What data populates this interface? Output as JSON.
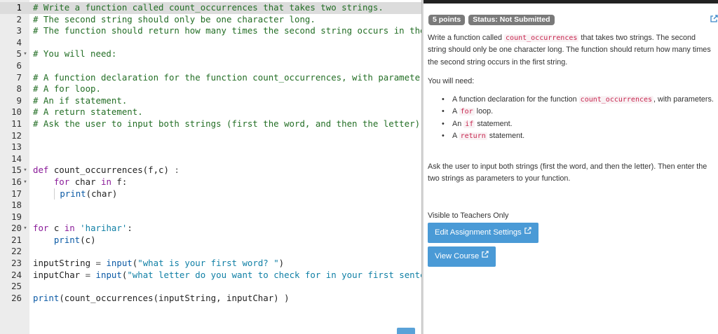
{
  "editor": {
    "lines": [
      {
        "n": "1",
        "fold": "",
        "parts": [
          [
            "comment",
            "# Write a function called count_occurrences that takes two strings."
          ]
        ]
      },
      {
        "n": "2",
        "fold": "",
        "parts": [
          [
            "comment",
            "# The second string should only be one character long."
          ]
        ]
      },
      {
        "n": "3",
        "fold": "",
        "parts": [
          [
            "comment",
            "# The function should return how many times the second string occurs in the"
          ]
        ]
      },
      {
        "n": "4",
        "fold": "",
        "parts": []
      },
      {
        "n": "5",
        "fold": "▾",
        "parts": [
          [
            "comment",
            "# You will need:"
          ]
        ]
      },
      {
        "n": "6",
        "fold": "",
        "parts": []
      },
      {
        "n": "7",
        "fold": "",
        "parts": [
          [
            "comment",
            "# A function declaration for the function count_occurrences, with parameters"
          ]
        ]
      },
      {
        "n": "8",
        "fold": "",
        "parts": [
          [
            "comment",
            "# A for loop."
          ]
        ]
      },
      {
        "n": "9",
        "fold": "",
        "parts": [
          [
            "comment",
            "# An if statement."
          ]
        ]
      },
      {
        "n": "10",
        "fold": "",
        "parts": [
          [
            "comment",
            "# A return statement."
          ]
        ]
      },
      {
        "n": "11",
        "fold": "",
        "parts": [
          [
            "comment",
            "# Ask the user to input both strings (first the word, and then the letter)."
          ]
        ]
      },
      {
        "n": "12",
        "fold": "",
        "parts": []
      },
      {
        "n": "13",
        "fold": "",
        "parts": []
      },
      {
        "n": "14",
        "fold": "",
        "parts": []
      },
      {
        "n": "15",
        "fold": "▾",
        "parts": [
          [
            "keyword",
            "def"
          ],
          [
            "plain",
            " count_occurrences(f,c) "
          ],
          [
            "op",
            ":"
          ]
        ]
      },
      {
        "n": "16",
        "fold": "▾",
        "parts": [
          [
            "plain",
            "    "
          ],
          [
            "keyword",
            "for"
          ],
          [
            "plain",
            " char "
          ],
          [
            "keyword",
            "in"
          ],
          [
            "plain",
            " f:"
          ]
        ]
      },
      {
        "n": "17",
        "fold": "",
        "parts": [
          [
            "plain",
            "    "
          ],
          [
            "guide",
            ""
          ],
          [
            "plain",
            " "
          ],
          [
            "builtin",
            "print"
          ],
          [
            "plain",
            "(char)"
          ]
        ]
      },
      {
        "n": "18",
        "fold": "",
        "parts": []
      },
      {
        "n": "19",
        "fold": "",
        "parts": []
      },
      {
        "n": "20",
        "fold": "▾",
        "parts": [
          [
            "keyword",
            "for"
          ],
          [
            "plain",
            " c "
          ],
          [
            "keyword",
            "in"
          ],
          [
            "plain",
            " "
          ],
          [
            "string",
            "'harihar'"
          ],
          [
            "plain",
            ":"
          ]
        ]
      },
      {
        "n": "21",
        "fold": "",
        "parts": [
          [
            "plain",
            "    "
          ],
          [
            "builtin",
            "print"
          ],
          [
            "plain",
            "(c)"
          ]
        ]
      },
      {
        "n": "22",
        "fold": "",
        "parts": []
      },
      {
        "n": "23",
        "fold": "",
        "parts": [
          [
            "plain",
            "inputString "
          ],
          [
            "op",
            "="
          ],
          [
            "plain",
            " "
          ],
          [
            "builtin",
            "input"
          ],
          [
            "plain",
            "("
          ],
          [
            "string",
            "\"what is your first word? \""
          ],
          [
            "plain",
            ")"
          ]
        ]
      },
      {
        "n": "24",
        "fold": "",
        "parts": [
          [
            "plain",
            "inputChar "
          ],
          [
            "op",
            "="
          ],
          [
            "plain",
            " "
          ],
          [
            "builtin",
            "input"
          ],
          [
            "plain",
            "("
          ],
          [
            "string",
            "\"what letter do you want to check for in your first senter"
          ]
        ]
      },
      {
        "n": "25",
        "fold": "",
        "parts": []
      },
      {
        "n": "26",
        "fold": "",
        "parts": [
          [
            "builtin",
            "print"
          ],
          [
            "plain",
            "(count_occurrences(inputString, inputChar) )"
          ]
        ]
      }
    ],
    "active_line": "1"
  },
  "assignment": {
    "points_badge": "5 points",
    "status_badge": "Status: Not Submitted",
    "description_before": "Write a function called ",
    "description_code": "count_occurrences",
    "description_after": " that takes two strings. The second string should only be one character long. The function should return how many times the second string occurs in the first string.",
    "you_will_need": "You will need:",
    "requirements": [
      {
        "before": "A function declaration for the function ",
        "code": "count_occurrences",
        "after": ", with parameters."
      },
      {
        "before": "A ",
        "code": "for",
        "after": " loop."
      },
      {
        "before": "An ",
        "code": "if",
        "after": " statement."
      },
      {
        "before": "A ",
        "code": "return",
        "after": " statement."
      }
    ],
    "ask_text": "Ask the user to input both strings (first the word, and then the letter). Then enter the two strings as parameters to your function.",
    "visible_note": "Visible to Teachers Only",
    "edit_settings_label": "Edit Assignment Settings",
    "view_course_label": "View Course"
  },
  "icons": {
    "external_link": "external-link-icon",
    "expand": "expand-icon",
    "fold": "fold-arrow-icon"
  },
  "colors": {
    "button_bg": "#4a9ad6",
    "badge_bg": "#7a7a7a",
    "comment": "#236e25",
    "keyword": "#8a1b99",
    "string": "#0f7fa5"
  }
}
